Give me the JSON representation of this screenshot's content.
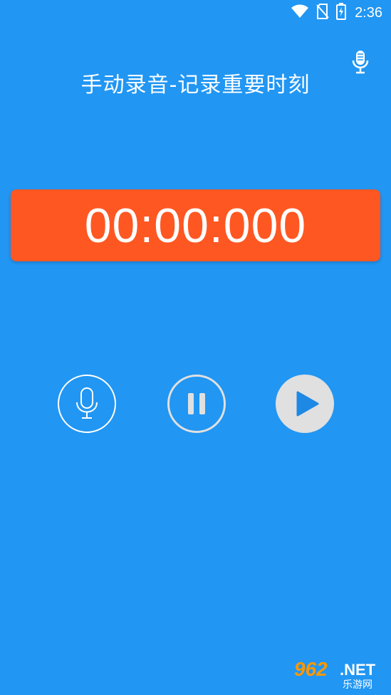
{
  "status_bar": {
    "time": "2:36",
    "icons": [
      "wifi-icon",
      "no-sim-icon",
      "battery-charging-icon"
    ]
  },
  "header": {
    "title": "手动录音-记录重要时刻",
    "mic_icon": "microphone-icon"
  },
  "timer": {
    "value": "00:00:000"
  },
  "controls": [
    {
      "name": "record",
      "icon": "microphone-icon"
    },
    {
      "name": "pause",
      "icon": "pause-icon"
    },
    {
      "name": "play",
      "icon": "play-icon"
    }
  ],
  "watermark": {
    "number": "962",
    "suffix": ".NET",
    "text": "乐游网"
  },
  "colors": {
    "background": "#2196f3",
    "timer_background": "#ff5722",
    "button_light": "#e0e0e0",
    "play_triangle": "#1e88e5"
  }
}
